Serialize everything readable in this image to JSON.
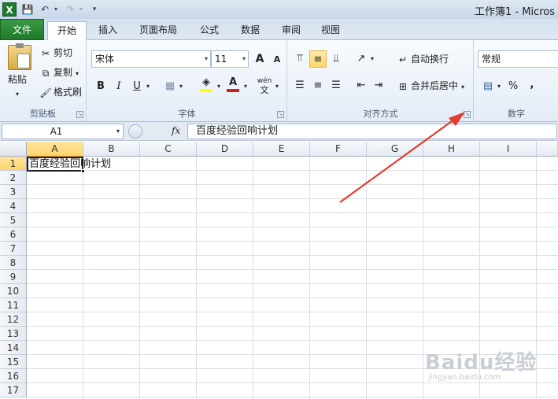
{
  "window": {
    "title": "工作簿1 - Micros",
    "app_icon": "X",
    "quick_access": [
      "save-icon",
      "undo-icon",
      "redo-icon",
      "customize-icon"
    ]
  },
  "tabs": [
    {
      "label": "文件"
    },
    {
      "label": "开始"
    },
    {
      "label": "插入"
    },
    {
      "label": "页面布局"
    },
    {
      "label": "公式"
    },
    {
      "label": "数据"
    },
    {
      "label": "审阅"
    },
    {
      "label": "视图"
    }
  ],
  "ribbon": {
    "clipboard": {
      "label": "剪贴板",
      "paste": "粘贴",
      "cut": "剪切",
      "copy": "复制",
      "format_painter": "格式刷"
    },
    "font": {
      "label": "字体",
      "font_name": "宋体",
      "font_size": "11",
      "grow": "A",
      "shrink": "A",
      "bold": "B",
      "italic": "I",
      "underline": "U",
      "font_color": "A",
      "phonetic": "wén"
    },
    "alignment": {
      "label": "对齐方式",
      "wrap_text": "自动换行",
      "merge_center": "合并后居中"
    },
    "number": {
      "label": "数字",
      "format": "常规",
      "percent": "%",
      "comma": ","
    }
  },
  "formula_bar": {
    "name_box": "A1",
    "fx": "fx",
    "content": "百度经验回响计划"
  },
  "grid": {
    "columns": [
      "A",
      "B",
      "C",
      "D",
      "E",
      "F",
      "G",
      "H",
      "I"
    ],
    "rows": [
      "1",
      "2",
      "3",
      "4",
      "5",
      "6",
      "7",
      "8",
      "9",
      "10",
      "11",
      "12",
      "13",
      "14",
      "15",
      "16",
      "17"
    ],
    "selected_cell": "A1",
    "a1_text": "百度经验回响计划"
  },
  "colors": {
    "accent_green": "#1e7a2a",
    "selection_gold": "#ffd36a",
    "annotation_red": "#e33b2e"
  },
  "watermark": {
    "brand": "Baidu经验",
    "url": "jingyan.baidu.com"
  }
}
